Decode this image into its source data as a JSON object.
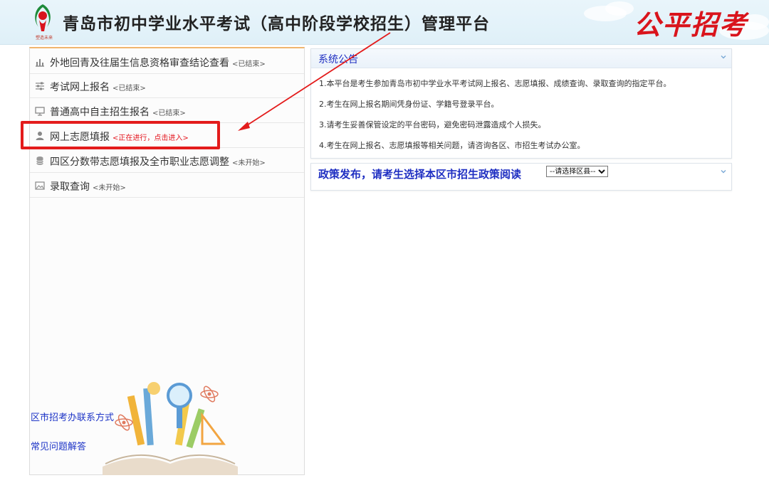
{
  "header": {
    "title": "青岛市初中学业水平考试（高中阶段学校招生）管理平台",
    "logo_tagline": "塑造未来",
    "slogan": "公平招考"
  },
  "menu": {
    "items": [
      {
        "label": "外地回青及往届生信息资格审查结论查看",
        "status": "<已结束>",
        "icon": "bar-chart-icon"
      },
      {
        "label": "考试网上报名",
        "status": "<已结束>",
        "icon": "sliders-icon"
      },
      {
        "label": "普通高中自主招生报名",
        "status": "<已结束>",
        "icon": "monitor-icon"
      },
      {
        "label": "网上志愿填报",
        "status": "<正在进行，点击进入>",
        "icon": "user-icon"
      },
      {
        "label": "四区分数带志愿填报及全市职业志愿调整",
        "status": "<未开始>",
        "icon": "database-icon"
      },
      {
        "label": "录取查询",
        "status": "<未开始>",
        "icon": "image-icon"
      }
    ]
  },
  "side_links": {
    "contacts": "区市招考办联系方式",
    "faq": "常见问题解答"
  },
  "announcement": {
    "title": "系统公告",
    "lines": [
      "1.本平台是考生参加青岛市初中学业水平考试网上报名、志愿填报、成绩查询、录取查询的指定平台。",
      "2.考生在网上报名期间凭身份证、学籍号登录平台。",
      "3.请考生妥善保管设定的平台密码，避免密码泄露造成个人损失。",
      "4.考生在网上报名、志愿填报等相关问题，请咨询各区、市招生考试办公室。"
    ]
  },
  "policy": {
    "title": "政策发布，请考生选择本区市招生政策阅读",
    "select_value": "--请选择区县--"
  },
  "colors": {
    "accent_blue": "#1f2fc2",
    "highlight_red": "#e31b1b",
    "status_active": "#e3141c"
  }
}
